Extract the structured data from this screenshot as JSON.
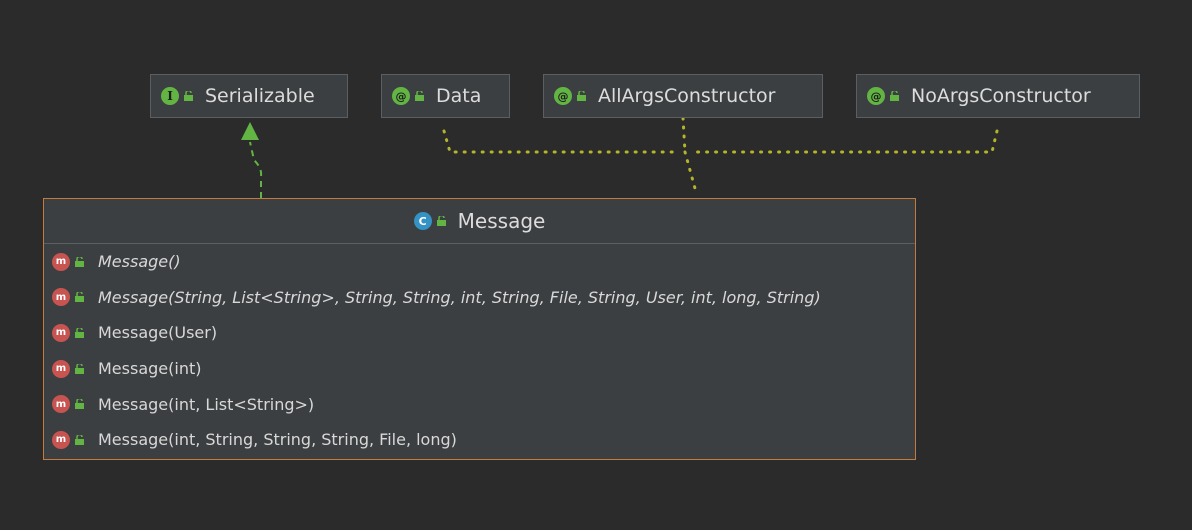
{
  "interfaces": [
    {
      "label": "Serializable",
      "badge": "I"
    }
  ],
  "annotations": [
    {
      "label": "Data",
      "badge": "@"
    },
    {
      "label": "AllArgsConstructor",
      "badge": "@"
    },
    {
      "label": "NoArgsConstructor",
      "badge": "@"
    }
  ],
  "class_box": {
    "name": "Message",
    "badge": "C",
    "methods": [
      {
        "badge": "m",
        "signature": "Message()",
        "italic": true
      },
      {
        "badge": "m",
        "signature": "Message(String, List<String>, String, String, int, String, File, String, User, int, long, String)",
        "italic": true
      },
      {
        "badge": "m",
        "signature": "Message(User)",
        "italic": false
      },
      {
        "badge": "m",
        "signature": "Message(int)",
        "italic": false
      },
      {
        "badge": "m",
        "signature": "Message(int, List<String>)",
        "italic": false
      },
      {
        "badge": "m",
        "signature": "Message(int, String, String, String, File, long)",
        "italic": false
      }
    ]
  },
  "colors": {
    "background": "#2b2b2b",
    "box": "#3c3f41",
    "interface_badge": "#62b543",
    "class_badge": "#3592c4",
    "method_badge": "#c75450",
    "class_border": "#c47a39",
    "implements_arrow": "#62b543",
    "annotation_link": "#b5b52a"
  }
}
